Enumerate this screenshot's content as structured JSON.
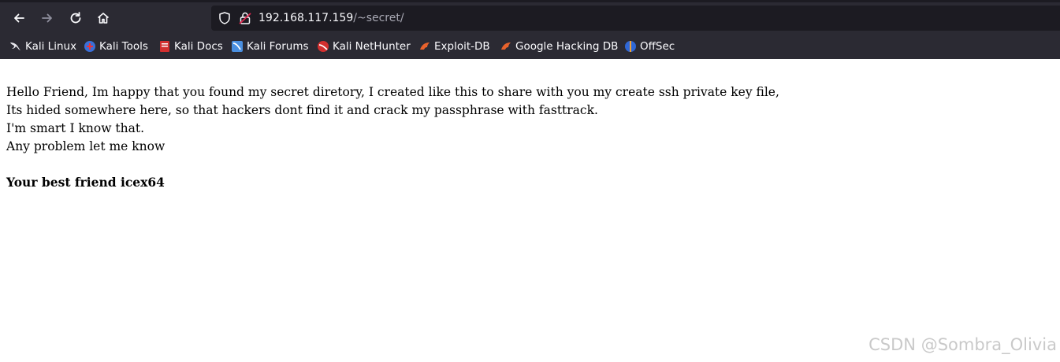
{
  "toolbar": {
    "back_icon": "arrow-left",
    "forward_icon": "arrow-right",
    "reload_icon": "reload",
    "home_icon": "home"
  },
  "urlbar": {
    "host": "192.168.117.159",
    "path": "/~secret/"
  },
  "bookmarks": [
    {
      "label": "Kali Linux",
      "icon": "kali-dragon-icon"
    },
    {
      "label": "Kali Tools",
      "icon": "kali-tools-icon"
    },
    {
      "label": "Kali Docs",
      "icon": "kali-docs-icon"
    },
    {
      "label": "Kali Forums",
      "icon": "kali-forums-icon"
    },
    {
      "label": "Kali NetHunter",
      "icon": "kali-nethunter-icon"
    },
    {
      "label": "Exploit-DB",
      "icon": "exploit-db-icon"
    },
    {
      "label": "Google Hacking DB",
      "icon": "ghdb-icon"
    },
    {
      "label": "OffSec",
      "icon": "offsec-icon"
    }
  ],
  "page": {
    "lines": [
      "Hello Friend, Im happy that you found my secret diretory, I created like this to share with you my create ssh private key file,",
      "Its hided somewhere here, so that hackers dont find it and crack my passphrase with fasttrack.",
      "I'm smart I know that.",
      "Any problem let me know"
    ],
    "signature": "Your best friend icex64"
  },
  "watermark": "CSDN @Sombra_Olivia",
  "colors": {
    "toolbar_bg": "#2b2a33",
    "urlbar_bg": "#1c1b22",
    "page_bg": "#ffffff"
  }
}
